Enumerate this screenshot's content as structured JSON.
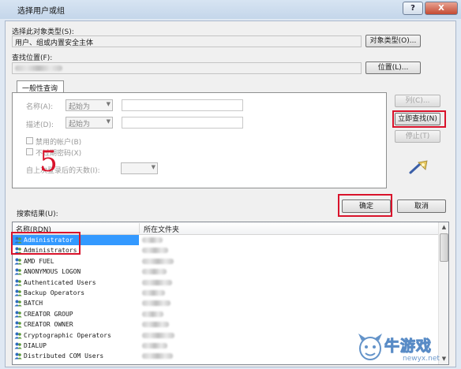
{
  "window": {
    "title": "选择用户或组",
    "help_label": "?",
    "close_label": "X"
  },
  "object_type": {
    "label": "选择此对象类型(S):",
    "value": "用户、组或内置安全主体",
    "button": "对象类型(O)..."
  },
  "location": {
    "label": "查找位置(F):",
    "button": "位置(L)..."
  },
  "query": {
    "tab": "一般性查询",
    "name_label": "名称(A):",
    "name_mode": "起始为",
    "desc_label": "描述(D):",
    "desc_mode": "起始为",
    "disabled_accounts": "禁用的帐户(B)",
    "no_expire_pw": "不过期密码(X)",
    "days_since_logon": "自上次登录后的天数(I):",
    "btn_columns": "列(C)...",
    "btn_find_now": "立即查找(N)",
    "btn_stop": "停止(T)"
  },
  "annotation_number": "5",
  "results": {
    "label": "搜索结果(U):",
    "ok": "确定",
    "cancel": "取消",
    "columns": [
      "名称(RDN)",
      "所在文件夹"
    ],
    "rows": [
      "Administrator",
      "Administrators",
      "AMD FUEL",
      "ANONYMOUS LOGON",
      "Authenticated Users",
      "Backup Operators",
      "BATCH",
      "CREATOR GROUP",
      "CREATOR OWNER",
      "Cryptographic Operators",
      "DIALUP",
      "Distributed COM Users"
    ],
    "selected_index": 0
  },
  "watermark": {
    "text": "牛游戏",
    "url": "newyx.net"
  },
  "colors": {
    "selection": "#3399ff",
    "annotation_red": "#d9132b"
  }
}
